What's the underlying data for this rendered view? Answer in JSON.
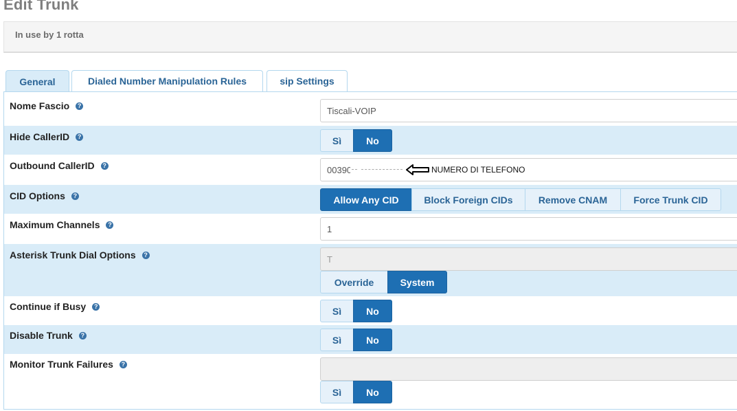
{
  "page": {
    "title": "Edit Trunk"
  },
  "info": {
    "text": "In use by 1 rotta"
  },
  "tabs": [
    {
      "label": "General",
      "active": true
    },
    {
      "label": "Dialed Number Manipulation Rules",
      "active": false
    },
    {
      "label": "sip Settings",
      "active": false
    }
  ],
  "fields": {
    "nome_fascio": {
      "label": "Nome Fascio",
      "value": "Tiscali-VOIP"
    },
    "hide_callerid": {
      "label": "Hide CallerID",
      "options": [
        "Sì",
        "No"
      ],
      "selected": "No"
    },
    "outbound_callerid": {
      "label": "Outbound CallerID",
      "value": "00390"
    },
    "cid_options": {
      "label": "CID Options",
      "options": [
        "Allow Any CID",
        "Block Foreign CIDs",
        "Remove CNAM",
        "Force Trunk CID"
      ],
      "selected": "Allow Any CID"
    },
    "max_channels": {
      "label": "Maximum Channels",
      "value": "1"
    },
    "dial_options": {
      "label": "Asterisk Trunk Dial Options",
      "value": "T",
      "options": [
        "Override",
        "System"
      ],
      "selected": "System"
    },
    "continue_busy": {
      "label": "Continue if Busy",
      "options": [
        "Sì",
        "No"
      ],
      "selected": "No"
    },
    "disable_trunk": {
      "label": "Disable Trunk",
      "options": [
        "Sì",
        "No"
      ],
      "selected": "No"
    },
    "monitor_failures": {
      "label": "Monitor Trunk Failures",
      "value": "",
      "options": [
        "Sì",
        "No"
      ],
      "selected": "No"
    }
  },
  "annotation": {
    "text": "NUMERO DI TELEFONO",
    "icon": "left-arrow-icon"
  },
  "colors": {
    "accent": "#1e6fb3",
    "row_shade": "#d9ecf8",
    "link": "#2a6496",
    "help_icon": "#3a73a8"
  }
}
